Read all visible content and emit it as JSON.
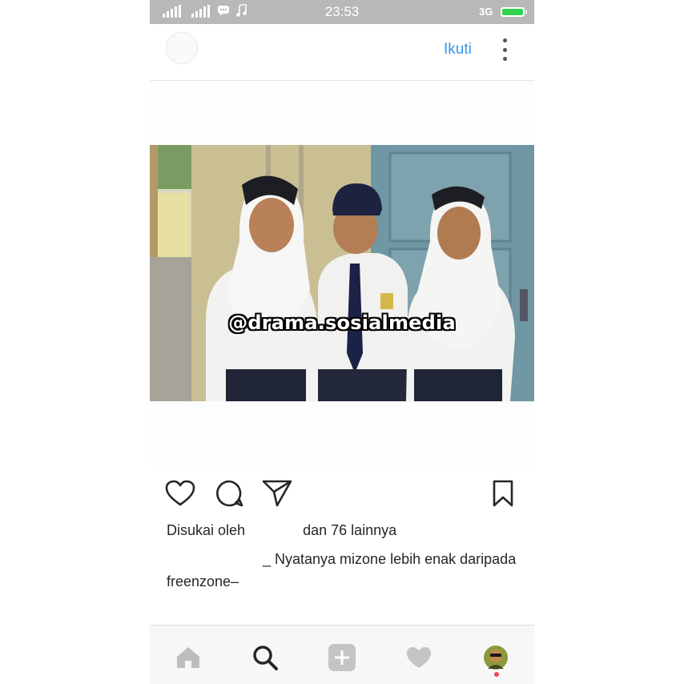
{
  "status_bar": {
    "time": "23:53",
    "network": "3G",
    "battery_color": "#2fd24a"
  },
  "post": {
    "follow_label": "Ikuti",
    "watermark": "@drama.sosialmedia",
    "likes_prefix": "Disukai oleh",
    "likes_suffix": "dan 76 lainnya",
    "caption": "_ Nyatanya mizone lebih enak daripada freenzone–"
  },
  "actions": {
    "icons": [
      "heart-icon",
      "comment-icon",
      "share-icon",
      "bookmark-icon"
    ]
  },
  "bottom_nav": {
    "items": [
      "home-icon",
      "search-icon",
      "add-icon",
      "activity-icon",
      "profile-avatar"
    ],
    "notification_color": "#ed4956"
  },
  "accent_color": "#3897f0"
}
